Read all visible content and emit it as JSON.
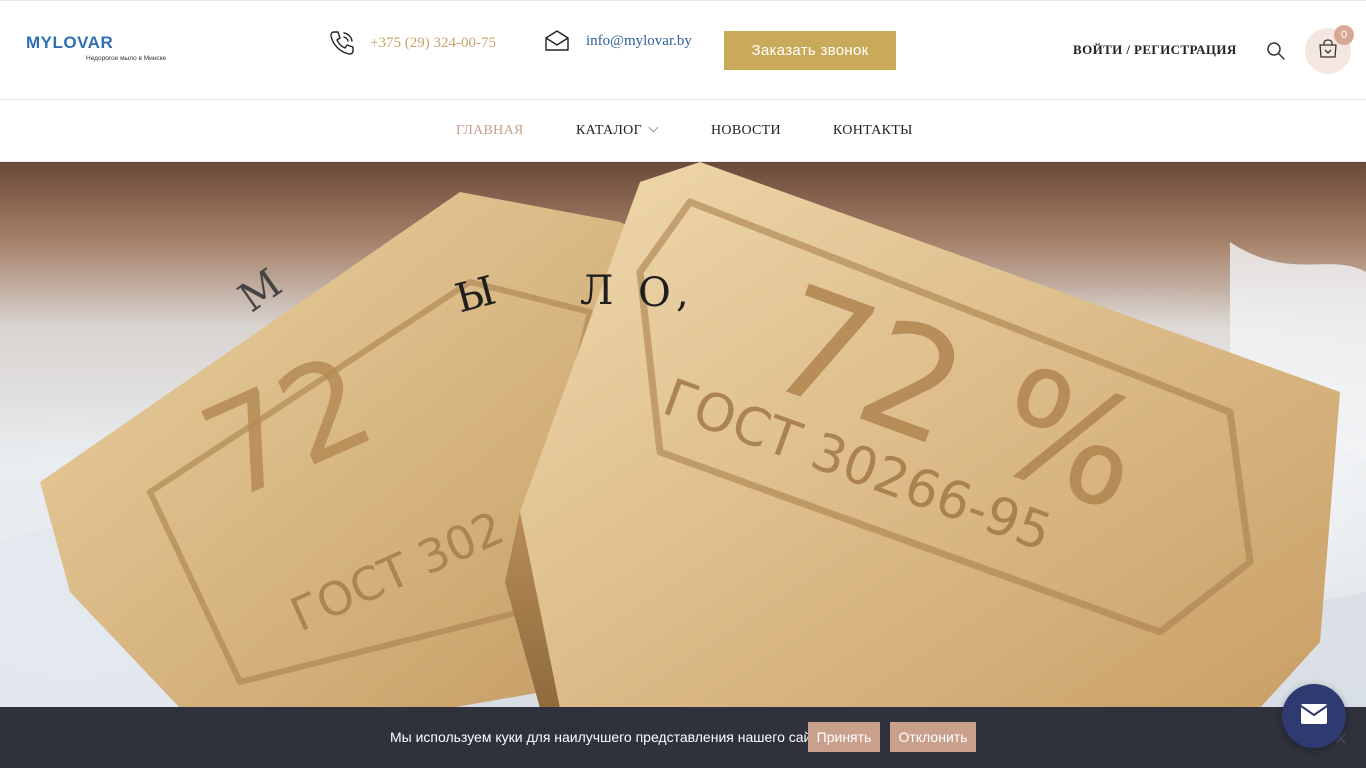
{
  "header": {
    "logo_title": "MYLOVAR",
    "logo_subtitle": "Недорогое мыло в Минске",
    "phone": "+375 (29) 324-00-75",
    "email": "info@mylovar.by",
    "order_call_label": "Заказать звонок",
    "login_label": "ВОЙТИ / РЕГИСТРАЦИЯ",
    "cart_count": "0",
    "icons": [
      "phone-icon",
      "mail-icon",
      "search-icon",
      "cart-icon"
    ]
  },
  "nav": {
    "items": [
      {
        "label": "ГЛАВНАЯ",
        "active": true
      },
      {
        "label": "КАТАЛОГ",
        "has_dropdown": true
      },
      {
        "label": "НОВОСТИ"
      },
      {
        "label": "КОНТАКТЫ"
      }
    ]
  },
  "hero": {
    "letters": [
      "М",
      "Ы",
      "Л",
      "О",
      ","
    ],
    "soap_stamp": {
      "percent": "72 %",
      "gost_full": "ГОСТ 30266-95",
      "gost_partial": "ГОСТ 302"
    }
  },
  "cookie": {
    "text": "Мы используем куки для наилучшего представления нашего сайта.",
    "accept_label": "Принять",
    "decline_label": "Отклонить",
    "close_symbol": "✕"
  },
  "colors": {
    "accent_gold": "#c8aa5a",
    "accent_rose": "#c9a08c",
    "logo_blue": "#2f6fb5",
    "cookie_bg": "#2f323c",
    "chat_bg": "#2e3a70"
  }
}
